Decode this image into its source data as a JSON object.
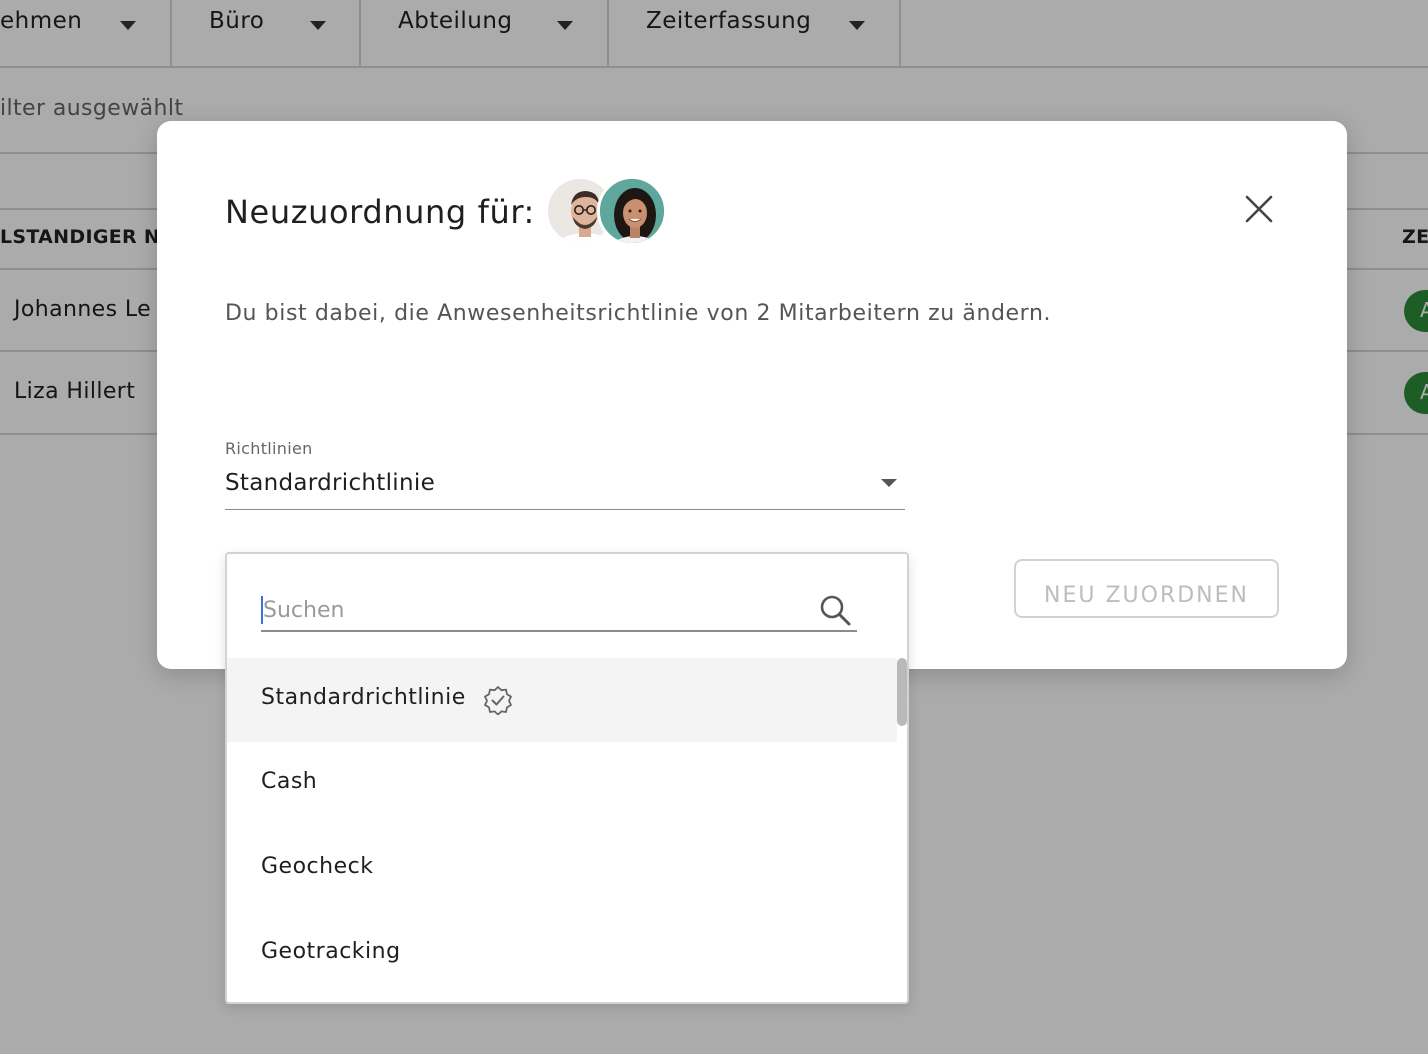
{
  "filters": [
    {
      "label": "ehmen"
    },
    {
      "label": "Büro"
    },
    {
      "label": "Abteilung"
    },
    {
      "label": "Zeiterfassung"
    }
  ],
  "filter_status": "ilter ausgewählt",
  "table": {
    "headers": [
      "LSTANDIGER NA",
      "ZE"
    ],
    "rows": [
      {
        "name": "Johannes Le",
        "badge": "A"
      },
      {
        "name": "Liza Hillert",
        "badge": "A"
      }
    ]
  },
  "modal": {
    "title": "Neuzuordnung für:",
    "description": "Du bist dabei, die Anwesenheitsrichtlinie von 2 Mitarbeitern zu ändern.",
    "field_label": "Richtlinien",
    "selected_value": "Standardrichtlinie",
    "reassign_button": "NEU ZUORDNEN"
  },
  "dropdown": {
    "search_placeholder": "Suchen",
    "options": [
      {
        "label": "Standardrichtlinie",
        "default": true
      },
      {
        "label": "Cash"
      },
      {
        "label": "Geocheck"
      },
      {
        "label": "Geotracking"
      }
    ]
  },
  "colors": {
    "accent_green": "#2e8b3a",
    "text_cursor": "#3a6fe0",
    "overlay": "rgba(0,0,0,0.33)"
  },
  "icons": [
    "chevron-down-icon",
    "close-icon",
    "search-icon",
    "verified-badge-icon"
  ]
}
